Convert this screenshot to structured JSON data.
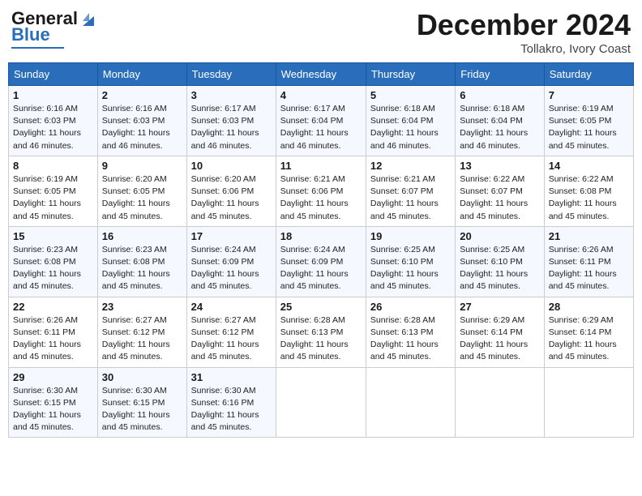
{
  "header": {
    "logo_general": "General",
    "logo_blue": "Blue",
    "month_title": "December 2024",
    "location": "Tollakro, Ivory Coast"
  },
  "calendar": {
    "days_of_week": [
      "Sunday",
      "Monday",
      "Tuesday",
      "Wednesday",
      "Thursday",
      "Friday",
      "Saturday"
    ],
    "weeks": [
      [
        {
          "day": "1",
          "info": "Sunrise: 6:16 AM\nSunset: 6:03 PM\nDaylight: 11 hours\nand 46 minutes."
        },
        {
          "day": "2",
          "info": "Sunrise: 6:16 AM\nSunset: 6:03 PM\nDaylight: 11 hours\nand 46 minutes."
        },
        {
          "day": "3",
          "info": "Sunrise: 6:17 AM\nSunset: 6:03 PM\nDaylight: 11 hours\nand 46 minutes."
        },
        {
          "day": "4",
          "info": "Sunrise: 6:17 AM\nSunset: 6:04 PM\nDaylight: 11 hours\nand 46 minutes."
        },
        {
          "day": "5",
          "info": "Sunrise: 6:18 AM\nSunset: 6:04 PM\nDaylight: 11 hours\nand 46 minutes."
        },
        {
          "day": "6",
          "info": "Sunrise: 6:18 AM\nSunset: 6:04 PM\nDaylight: 11 hours\nand 46 minutes."
        },
        {
          "day": "7",
          "info": "Sunrise: 6:19 AM\nSunset: 6:05 PM\nDaylight: 11 hours\nand 45 minutes."
        }
      ],
      [
        {
          "day": "8",
          "info": "Sunrise: 6:19 AM\nSunset: 6:05 PM\nDaylight: 11 hours\nand 45 minutes."
        },
        {
          "day": "9",
          "info": "Sunrise: 6:20 AM\nSunset: 6:05 PM\nDaylight: 11 hours\nand 45 minutes."
        },
        {
          "day": "10",
          "info": "Sunrise: 6:20 AM\nSunset: 6:06 PM\nDaylight: 11 hours\nand 45 minutes."
        },
        {
          "day": "11",
          "info": "Sunrise: 6:21 AM\nSunset: 6:06 PM\nDaylight: 11 hours\nand 45 minutes."
        },
        {
          "day": "12",
          "info": "Sunrise: 6:21 AM\nSunset: 6:07 PM\nDaylight: 11 hours\nand 45 minutes."
        },
        {
          "day": "13",
          "info": "Sunrise: 6:22 AM\nSunset: 6:07 PM\nDaylight: 11 hours\nand 45 minutes."
        },
        {
          "day": "14",
          "info": "Sunrise: 6:22 AM\nSunset: 6:08 PM\nDaylight: 11 hours\nand 45 minutes."
        }
      ],
      [
        {
          "day": "15",
          "info": "Sunrise: 6:23 AM\nSunset: 6:08 PM\nDaylight: 11 hours\nand 45 minutes."
        },
        {
          "day": "16",
          "info": "Sunrise: 6:23 AM\nSunset: 6:08 PM\nDaylight: 11 hours\nand 45 minutes."
        },
        {
          "day": "17",
          "info": "Sunrise: 6:24 AM\nSunset: 6:09 PM\nDaylight: 11 hours\nand 45 minutes."
        },
        {
          "day": "18",
          "info": "Sunrise: 6:24 AM\nSunset: 6:09 PM\nDaylight: 11 hours\nand 45 minutes."
        },
        {
          "day": "19",
          "info": "Sunrise: 6:25 AM\nSunset: 6:10 PM\nDaylight: 11 hours\nand 45 minutes."
        },
        {
          "day": "20",
          "info": "Sunrise: 6:25 AM\nSunset: 6:10 PM\nDaylight: 11 hours\nand 45 minutes."
        },
        {
          "day": "21",
          "info": "Sunrise: 6:26 AM\nSunset: 6:11 PM\nDaylight: 11 hours\nand 45 minutes."
        }
      ],
      [
        {
          "day": "22",
          "info": "Sunrise: 6:26 AM\nSunset: 6:11 PM\nDaylight: 11 hours\nand 45 minutes."
        },
        {
          "day": "23",
          "info": "Sunrise: 6:27 AM\nSunset: 6:12 PM\nDaylight: 11 hours\nand 45 minutes."
        },
        {
          "day": "24",
          "info": "Sunrise: 6:27 AM\nSunset: 6:12 PM\nDaylight: 11 hours\nand 45 minutes."
        },
        {
          "day": "25",
          "info": "Sunrise: 6:28 AM\nSunset: 6:13 PM\nDaylight: 11 hours\nand 45 minutes."
        },
        {
          "day": "26",
          "info": "Sunrise: 6:28 AM\nSunset: 6:13 PM\nDaylight: 11 hours\nand 45 minutes."
        },
        {
          "day": "27",
          "info": "Sunrise: 6:29 AM\nSunset: 6:14 PM\nDaylight: 11 hours\nand 45 minutes."
        },
        {
          "day": "28",
          "info": "Sunrise: 6:29 AM\nSunset: 6:14 PM\nDaylight: 11 hours\nand 45 minutes."
        }
      ],
      [
        {
          "day": "29",
          "info": "Sunrise: 6:30 AM\nSunset: 6:15 PM\nDaylight: 11 hours\nand 45 minutes."
        },
        {
          "day": "30",
          "info": "Sunrise: 6:30 AM\nSunset: 6:15 PM\nDaylight: 11 hours\nand 45 minutes."
        },
        {
          "day": "31",
          "info": "Sunrise: 6:30 AM\nSunset: 6:16 PM\nDaylight: 11 hours\nand 45 minutes."
        },
        {
          "day": "",
          "info": ""
        },
        {
          "day": "",
          "info": ""
        },
        {
          "day": "",
          "info": ""
        },
        {
          "day": "",
          "info": ""
        }
      ]
    ]
  }
}
